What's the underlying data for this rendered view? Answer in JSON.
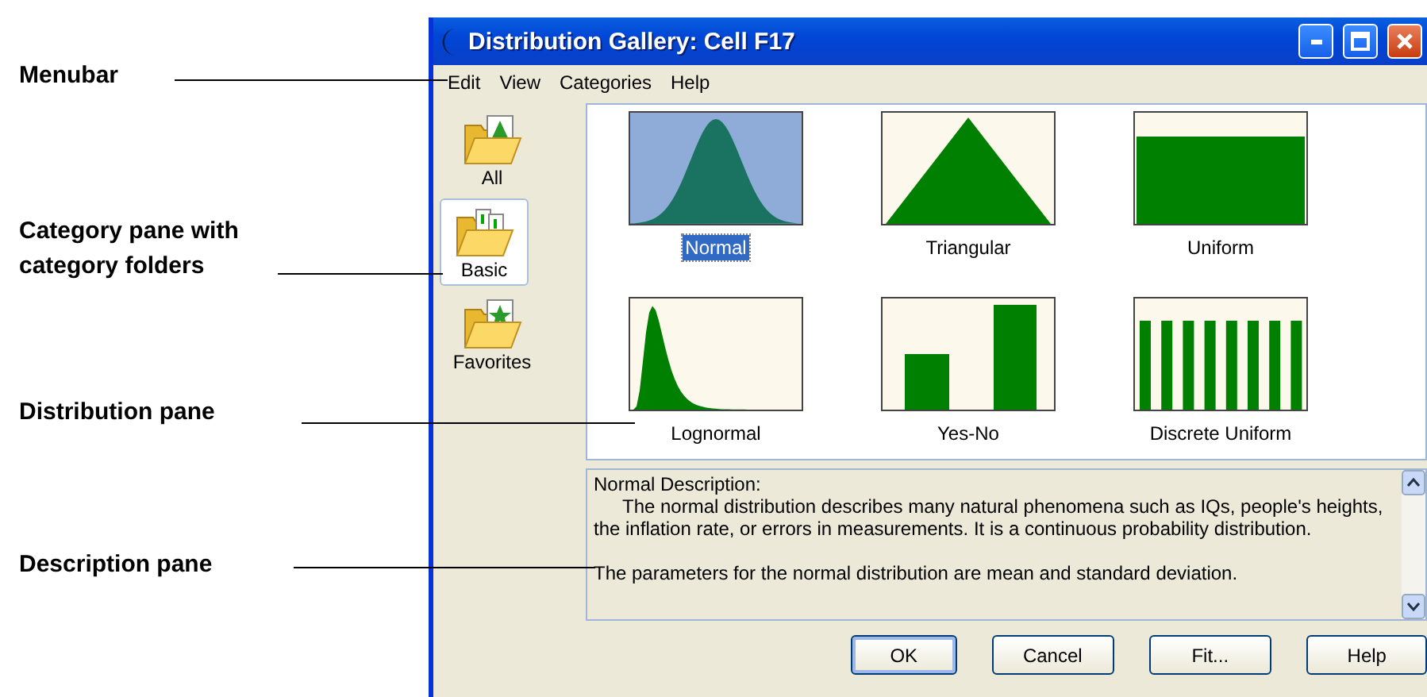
{
  "callouts": [
    {
      "label": "Menubar"
    },
    {
      "label": "Category pane with category folders"
    },
    {
      "label": "Distribution pane"
    },
    {
      "label": "Description pane"
    }
  ],
  "window": {
    "title": "Distribution Gallery: Cell F17"
  },
  "menu": [
    "Edit",
    "View",
    "Categories",
    "Help"
  ],
  "categories": [
    {
      "label": "All",
      "selected": false
    },
    {
      "label": "Basic",
      "selected": true
    },
    {
      "label": "Favorites",
      "selected": false
    }
  ],
  "distributions": [
    {
      "label": "Normal",
      "kind": "normal",
      "selected": true
    },
    {
      "label": "Triangular",
      "kind": "triangular",
      "selected": false
    },
    {
      "label": "Uniform",
      "kind": "uniform",
      "selected": false
    },
    {
      "label": "Lognormal",
      "kind": "lognormal",
      "selected": false
    },
    {
      "label": "Yes-No",
      "kind": "yesno",
      "selected": false
    },
    {
      "label": "Discrete Uniform",
      "kind": "discrete",
      "selected": false
    }
  ],
  "description": {
    "heading": "Normal Description:",
    "paragraphs": [
      "The normal distribution describes many natural phenomena such as IQs, people's heights, the inflation rate, or errors in measurements. It is a continuous probability distribution.",
      "The parameters for the normal distribution are mean and standard deviation."
    ]
  },
  "buttons": [
    {
      "label": "OK",
      "default": true
    },
    {
      "label": "Cancel",
      "default": false
    },
    {
      "label": "Fit...",
      "default": false
    },
    {
      "label": "Help",
      "default": false
    }
  ]
}
